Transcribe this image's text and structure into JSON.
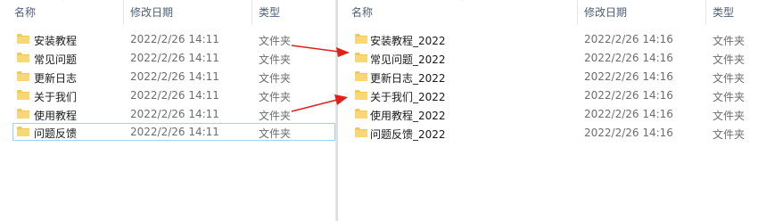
{
  "columns": {
    "name": "名称",
    "modified": "修改日期",
    "type": "类型"
  },
  "left_pane": {
    "rows": [
      {
        "name": "安装教程",
        "modified": "2022/2/26 14:11",
        "type": "文件夹"
      },
      {
        "name": "常见问题",
        "modified": "2022/2/26 14:11",
        "type": "文件夹"
      },
      {
        "name": "更新日志",
        "modified": "2022/2/26 14:11",
        "type": "文件夹"
      },
      {
        "name": "关于我们",
        "modified": "2022/2/26 14:11",
        "type": "文件夹"
      },
      {
        "name": "使用教程",
        "modified": "2022/2/26 14:11",
        "type": "文件夹"
      },
      {
        "name": "问题反馈",
        "modified": "2022/2/26 14:11",
        "type": "文件夹"
      }
    ]
  },
  "right_pane": {
    "rows": [
      {
        "name": "安装教程_2022",
        "modified": "2022/2/26 14:16",
        "type": "文件夹"
      },
      {
        "name": "常见问题_2022",
        "modified": "2022/2/26 14:16",
        "type": "文件夹"
      },
      {
        "name": "更新日志_2022",
        "modified": "2022/2/26 14:16",
        "type": "文件夹"
      },
      {
        "name": "关于我们_2022",
        "modified": "2022/2/26 14:16",
        "type": "文件夹"
      },
      {
        "name": "使用教程_2022",
        "modified": "2022/2/26 14:16",
        "type": "文件夹"
      },
      {
        "name": "问题反馈_2022",
        "modified": "2022/2/26 14:16",
        "type": "文件夹"
      }
    ]
  },
  "colors": {
    "folder": "#f4c855",
    "arrow": "#e0201b",
    "selection_border": "#99d1ff"
  }
}
